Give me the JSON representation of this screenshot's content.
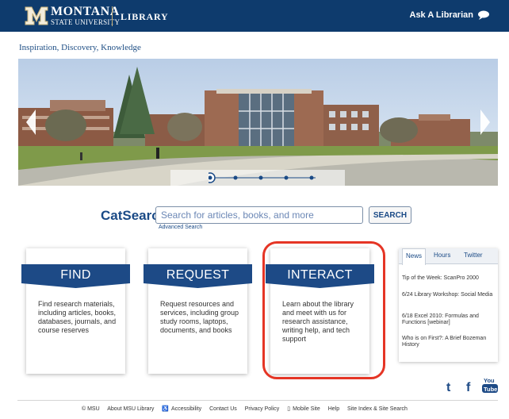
{
  "header": {
    "logo_name": "MONTANA",
    "logo_sub": "STATE UNIVERSITY",
    "section": "LIBRARY",
    "ask_label": "Ask A Librarian"
  },
  "tagline": "Inspiration, Discovery, Knowledge",
  "carousel": {
    "slide_count": 5,
    "active_index": 0
  },
  "catsearch": {
    "label": "CatSearch",
    "placeholder": "Search for articles, books, and more",
    "advanced": "Advanced Search",
    "button": "SEARCH"
  },
  "cards": [
    {
      "title": "FIND",
      "body": "Find research materials, including articles, books, databases, journals, and course reserves"
    },
    {
      "title": "REQUEST",
      "body": "Request resources and services, including group study rooms, laptops, documents, and books"
    },
    {
      "title": "INTERACT",
      "body": "Learn about the library and meet with us for research assistance, writing help, and tech support"
    }
  ],
  "tabs": {
    "labels": [
      "News",
      "Hours",
      "Twitter"
    ],
    "active": "News",
    "news": [
      "Tip of the Week: ScanPro 2000",
      "6/24 Library Workshop: Social Media",
      "6/18 Excel 2010: Formulas and Functions [webinar]",
      "Who is on First?: A Brief Bozeman History"
    ]
  },
  "social": {
    "tumblr": "t",
    "facebook": "f",
    "youtube_top": "You",
    "youtube_bottom": "Tube"
  },
  "footer": {
    "copyright": "© MSU",
    "links": [
      "About MSU Library",
      "Accessibility",
      "Contact Us",
      "Privacy Policy",
      "Mobile Site",
      "Help",
      "Site Index & Site Search"
    ]
  },
  "colors": {
    "navy": "#0e3b6d",
    "banner": "#1d4a86",
    "highlight": "#e53525",
    "gold": "#c9b37a"
  }
}
